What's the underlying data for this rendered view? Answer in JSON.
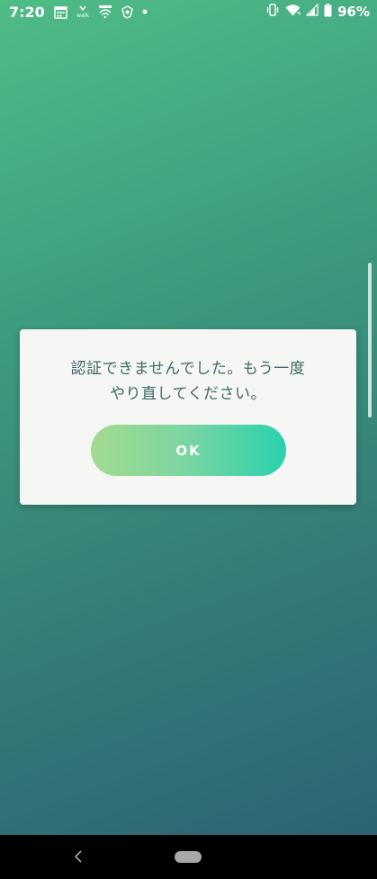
{
  "status_bar": {
    "time": "7:20",
    "left_icons": [
      "calendar-icon",
      "walk-icon",
      "wifi-calling-icon",
      "shield-app-icon",
      "notification-dot-icon"
    ],
    "walk_label": "walk",
    "right_icons": [
      "vibrate-icon",
      "wifi-icon",
      "signal-icon",
      "battery-icon"
    ],
    "battery_percent": "96%"
  },
  "dialog": {
    "message": "認証できませんでした。もう一度\nやり直してください。",
    "ok_label": "OK"
  },
  "colors": {
    "background_top": "#4fbc86",
    "background_bottom": "#2c5f74",
    "dialog_bg": "#f6f6f4",
    "message_text": "#3f6a68",
    "button_gradient_start": "#a3da8f",
    "button_gradient_end": "#28d1ad"
  },
  "nav_bar": {
    "icons": [
      "back-icon",
      "home-pill-icon"
    ]
  }
}
